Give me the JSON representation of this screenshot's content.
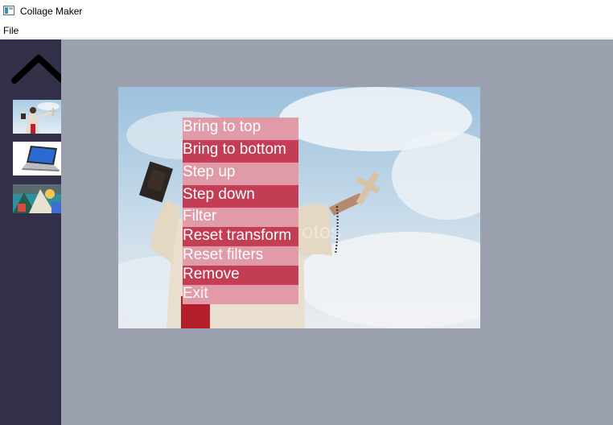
{
  "window": {
    "title": "Collage Maker"
  },
  "menubar": {
    "file_label": "File"
  },
  "sidebar": {
    "scroll_up_icon": "chevron-up-icon",
    "thumbnails": [
      {
        "subject": "figure with book and cross"
      },
      {
        "subject": "laptop"
      },
      {
        "subject": "colorful mural"
      }
    ]
  },
  "photo": {
    "watermark": "otos"
  },
  "context_menu": {
    "items": [
      {
        "label": "Bring to top",
        "style": "light"
      },
      {
        "label": "Bring to bottom",
        "style": "dark"
      },
      {
        "label": "Step up",
        "style": "light"
      },
      {
        "label": "Step down",
        "style": "dark"
      },
      {
        "label": "Filter",
        "style": "light"
      },
      {
        "label": "Reset transform",
        "style": "dark"
      },
      {
        "label": "Reset filters",
        "style": "light"
      },
      {
        "label": "Remove",
        "style": "dark"
      },
      {
        "label": "Exit",
        "style": "light"
      }
    ]
  },
  "colors": {
    "sidebar_bg": "#33314a",
    "canvas_bg": "#9aa0ad",
    "menu_item_light": "#e09aa8",
    "menu_item_dark": "#c33d55"
  }
}
